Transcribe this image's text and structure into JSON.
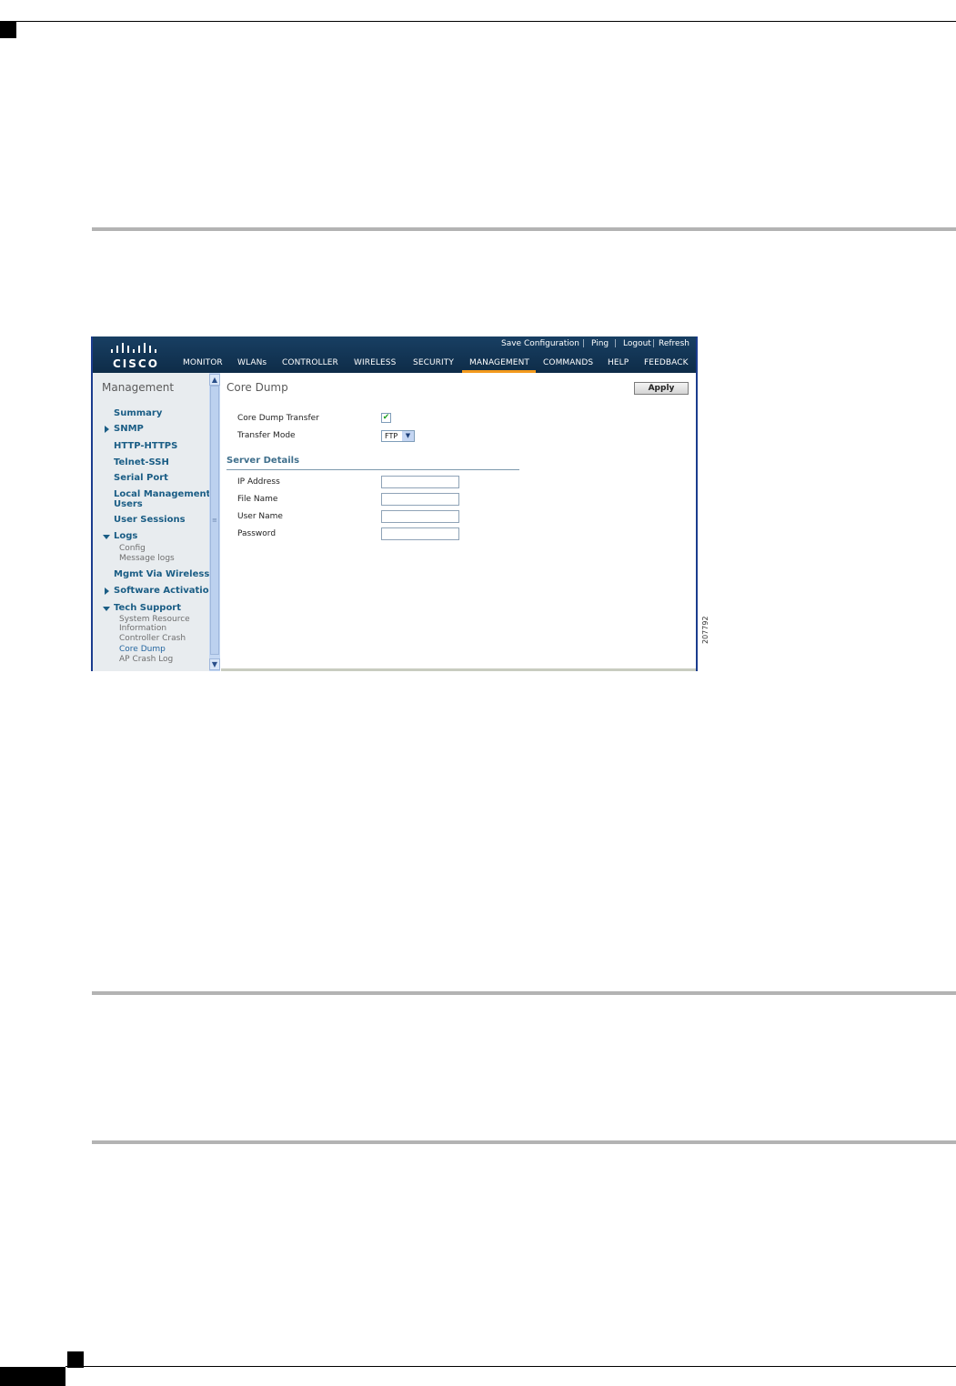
{
  "header": {
    "logo_text": "CISCO",
    "top_links": [
      "Save Configuration",
      "Ping",
      "Logout",
      "Refresh"
    ],
    "nav": [
      "MONITOR",
      "WLANs",
      "CONTROLLER",
      "WIRELESS",
      "SECURITY",
      "MANAGEMENT",
      "COMMANDS",
      "HELP",
      "FEEDBACK"
    ],
    "active_nav": "MANAGEMENT",
    "accent_color": "#f39a1d"
  },
  "sidebar": {
    "title": "Management",
    "items": [
      "Summary",
      "SNMP",
      "HTTP-HTTPS",
      "Telnet-SSH",
      "Serial Port",
      "Local Management",
      "Users",
      "User Sessions",
      "Logs",
      "Mgmt Via Wireless",
      "Software Activation",
      "Tech Support"
    ],
    "logs_sub": [
      "Config",
      "Message logs"
    ],
    "tech_sub": [
      "System Resource",
      "Information",
      "Controller Crash",
      "Core Dump",
      "AP Crash Log"
    ]
  },
  "main": {
    "title": "Core Dump",
    "apply_label": "Apply",
    "core_dump_transfer_label": "Core Dump Transfer",
    "core_dump_transfer_checked": true,
    "transfer_mode_label": "Transfer Mode",
    "transfer_mode_value": "FTP",
    "server_details_title": "Server Details",
    "fields": [
      "IP Address",
      "File Name",
      "User Name",
      "Password"
    ]
  },
  "figure_number": "207792"
}
